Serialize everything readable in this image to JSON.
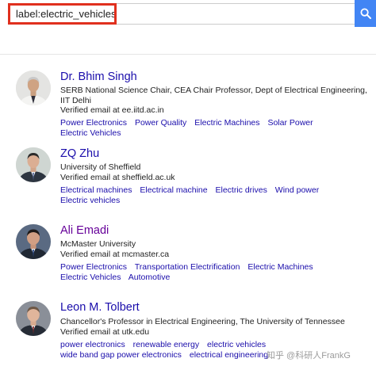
{
  "search": {
    "value": "label:electric_vehicles",
    "border_color": "#e0301e",
    "button_color": "#4285f4",
    "button_icon": "search-icon"
  },
  "profiles": [
    {
      "name": "Dr. Bhim Singh",
      "affiliation": "SERB National Science Chair, CEA Chair Professor, Dept of Electrical Engineering, IIT Delhi",
      "email": "Verified email at ee.iitd.ac.in",
      "interests": [
        "Power Electronics",
        "Power Quality",
        "Electric Machines",
        "Solar Power",
        "Electric Vehicles"
      ]
    },
    {
      "name": "ZQ Zhu",
      "affiliation": "University of Sheffield",
      "email": "Verified email at sheffield.ac.uk",
      "interests": [
        "Electrical machines",
        "Electrical machine",
        "Electric drives",
        "Wind power",
        "Electric vehicles"
      ]
    },
    {
      "name": "Ali Emadi",
      "affiliation": "McMaster University",
      "email": "Verified email at mcmaster.ca",
      "interests": [
        "Power Electronics",
        "Transportation Electrification",
        "Electric Machines",
        "Electric Vehicles",
        "Automotive"
      ]
    },
    {
      "name": "Leon M. Tolbert",
      "affiliation": "Chancellor's Professor in Electrical Engineering, The University of Tennessee",
      "email": "Verified email at utk.edu",
      "interests": [
        "power electronics",
        "renewable energy",
        "electric vehicles",
        "wide band gap power electronics",
        "electrical engineering"
      ]
    }
  ],
  "watermark": "知乎 @科研人FrankG",
  "colors": {
    "link": "#1a0dab",
    "visited_link": "#660099",
    "text": "#222222"
  }
}
